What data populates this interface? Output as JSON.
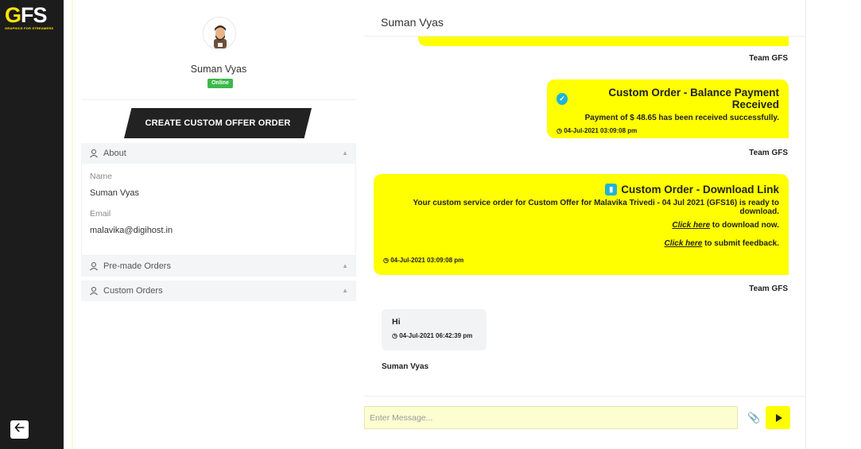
{
  "nav": {
    "logo_main": "GFS",
    "logo_g": "G",
    "logo_rest": "FS",
    "logo_sub": "GRAPHICS FOR STREAMERS",
    "back_icon": "arrow-left-icon"
  },
  "profile": {
    "name": "Suman Vyas",
    "status": "Online",
    "status_color": "#3cb94a",
    "create_button": "CREATE CUSTOM OFFER ORDER",
    "about_label": "About",
    "name_label": "Name",
    "name_value": "Suman Vyas",
    "email_label": "Email",
    "email_value": "malavika@digihost.in",
    "premade_label": "Pre-made Orders",
    "custom_label": "Custom Orders"
  },
  "chat": {
    "header": "Suman Vyas",
    "messages": [
      {
        "sender": "Team GFS"
      },
      {
        "title": "Custom Order - Balance Payment Received",
        "text": "Payment of $ 48.65 has been received successfully.",
        "time": "04-Jul-2021 03:09:08 pm",
        "sender": "Team GFS"
      },
      {
        "title": "Custom Order - Download Link",
        "text": "Your custom service order for Custom Offer for Malavika Trivedi - 04 Jul 2021 (GFS16) is ready to download.",
        "link1": "Click here",
        "link1_suffix": " to download now.",
        "link2": "Click here",
        "link2_suffix": " to submit feedback.",
        "time": "04-Jul-2021 03:09:08 pm",
        "sender": "Team GFS"
      },
      {
        "text": "Hi",
        "time": "04-Jul-2021 06:42:39 pm",
        "sender": "Suman Vyas"
      }
    ],
    "input_placeholder": "Enter Message...",
    "accent_color": "#ffff00"
  }
}
